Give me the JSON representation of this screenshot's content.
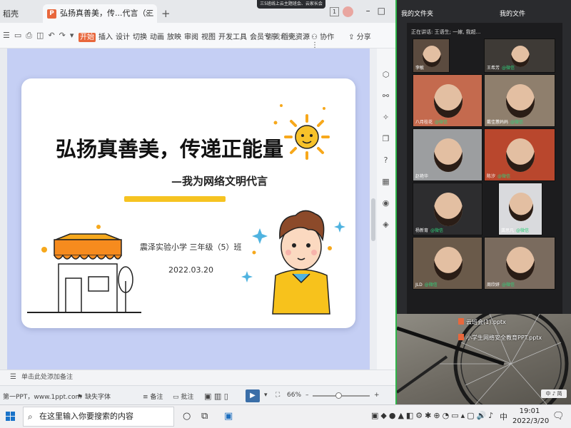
{
  "wps": {
    "home_tab": "稻壳",
    "doc_tab": "弘扬真善美，传...代言（三5班）",
    "tab_icon": "P",
    "meeting_banner": "三5班线上云主题班会、云家长会",
    "page_badge": "1",
    "menu": [
      "开始",
      "插入",
      "设计",
      "切换",
      "动画",
      "放映",
      "审阅",
      "视图",
      "开发工具",
      "会员专享",
      "稻壳资源"
    ],
    "search": "查找命令...",
    "collab": "协作",
    "share": "分享",
    "notes": "单击此处添加备注",
    "status_left": "第一PPT，www.1ppt.com",
    "missing_font": "缺失字体",
    "remark": "备注",
    "annotate": "批注",
    "zoom": "66%"
  },
  "slide": {
    "title": "弘扬真善美，传递正能量",
    "subtitle": "—我为网络文明代言",
    "school": "震泽实验小学  三年级（5）班",
    "date": "2022.03.20"
  },
  "desktop": {
    "left_label": "我的文件夹",
    "right_label": "我的文件",
    "files": [
      "云班会(1).pptx",
      "小学生网络安全教育PPT.pptx"
    ],
    "ime": "中 ♪ 简"
  },
  "meeting": {
    "header": "正在讲话: 王语生; 一嫁, 我超...",
    "tiles": [
      {
        "name": "李敏",
        "color": "#5b4b3f"
      },
      {
        "name": "王希芳",
        "mic": "@微信",
        "color": "#3e3a36"
      },
      {
        "name": "八月桂花",
        "mic": "@微信",
        "color": "#c46a4e"
      },
      {
        "name": "戴佳蕙妈妈",
        "mic": "@微信",
        "color": "#8f7f6d"
      },
      {
        "name": "赵艳华",
        "color": "#9c9ea0"
      },
      {
        "name": "陈汐",
        "mic": "@微信",
        "color": "#b9472d"
      },
      {
        "name": "杨新育",
        "mic": "@微信",
        "color": "#2d2d2f"
      },
      {
        "name": "龚思凡",
        "mic": "@微信",
        "color": "#d9dadd"
      },
      {
        "name": "JLD",
        "mic": "@微信",
        "color": "#6a5a4a"
      },
      {
        "name": "周欣妍",
        "mic": "@微信",
        "color": "#7a6b5e"
      }
    ]
  },
  "taskbar": {
    "search": "在这里输入你要搜索的内容",
    "time": "19:01",
    "date": "2022/3/20",
    "ime": "中"
  }
}
